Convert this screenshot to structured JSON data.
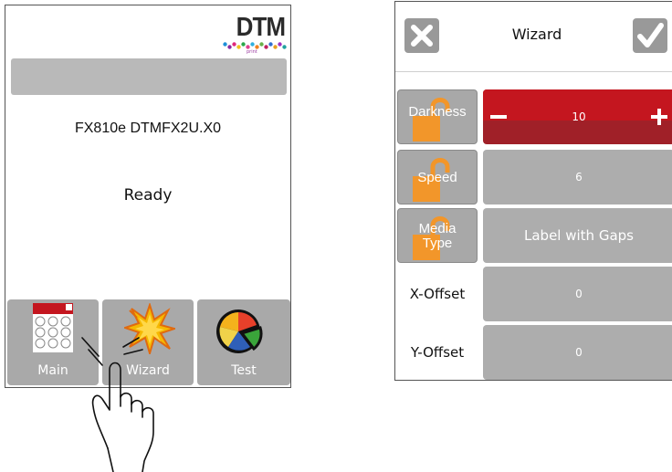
{
  "left_screen": {
    "logo": {
      "text": "DTM",
      "subtext": "print",
      "dot_colors": [
        "#1e90d8",
        "#8a2ca0",
        "#e0287a",
        "#f0c020",
        "#2aa84a",
        "#e04090",
        "#30b0e0",
        "#f08020",
        "#6ab04a",
        "#c02060",
        "#3070d0",
        "#e8a020",
        "#a030c0",
        "#20a0a0"
      ]
    },
    "model": "FX810e DTMFX2U.X0",
    "status": "Ready",
    "nav": {
      "main_label": "Main",
      "wizard_label": "Wizard",
      "test_label": "Test"
    }
  },
  "right_screen": {
    "title": "Wizard",
    "rows": {
      "darkness": {
        "label": "Darkness",
        "value": "10"
      },
      "speed": {
        "label": "Speed",
        "value": "6"
      },
      "media_type": {
        "label_line1": "Media",
        "label_line2": "Type",
        "value": "Label with Gaps"
      },
      "x_offset": {
        "label": "X-Offset",
        "value": "0"
      },
      "y_offset": {
        "label": "Y-Offset",
        "value": "0"
      }
    },
    "colors": {
      "active": "#c4161f",
      "lock": "#f2962a",
      "button_gray": "#a8a8a8"
    }
  }
}
